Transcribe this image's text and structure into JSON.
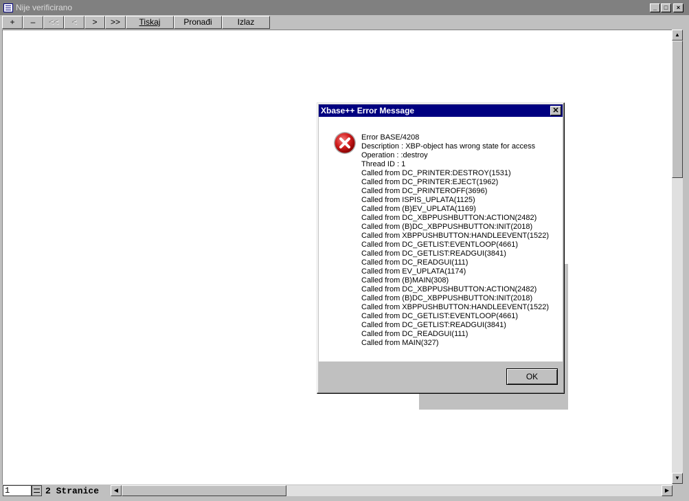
{
  "window": {
    "title": "Nije verificirano",
    "controls": [
      "_",
      "□",
      "×"
    ]
  },
  "toolbar": {
    "buttons": [
      {
        "label": "+",
        "enabled": true
      },
      {
        "label": "–",
        "enabled": true
      },
      {
        "label": "<<",
        "enabled": false
      },
      {
        "label": "<",
        "enabled": false
      },
      {
        "label": ">",
        "enabled": true
      },
      {
        "label": ">>",
        "enabled": true
      },
      {
        "label": "Tiskaj",
        "enabled": true
      },
      {
        "label": "Pronađi",
        "enabled": true
      },
      {
        "label": "Izlaz",
        "enabled": true
      }
    ]
  },
  "status": {
    "page_value": "1",
    "pages_label": "2 Stranice"
  },
  "dialog": {
    "title": "Xbase++ Error Message",
    "icon": "error-icon",
    "lines": [
      "Error BASE/4208",
      "Description : XBP-object has wrong state for access",
      "Operation : :destroy",
      "Thread ID : 1",
      "Called from DC_PRINTER:DESTROY(1531)",
      "Called from DC_PRINTER:EJECT(1962)",
      "Called from DC_PRINTEROFF(3696)",
      "Called from ISPIS_UPLATA(1125)",
      "Called from (B)EV_UPLATA(1169)",
      "Called from DC_XBPPUSHBUTTON:ACTION(2482)",
      "Called from (B)DC_XBPPUSHBUTTON:INIT(2018)",
      "Called from XBPPUSHBUTTON:HANDLEEVENT(1522)",
      "Called from DC_GETLIST:EVENTLOOP(4661)",
      "Called from DC_GETLIST:READGUI(3841)",
      "Called from DC_READGUI(111)",
      "Called from EV_UPLATA(1174)",
      "Called from (B)MAIN(308)",
      "Called from DC_XBPPUSHBUTTON:ACTION(2482)",
      "Called from (B)DC_XBPPUSHBUTTON:INIT(2018)",
      "Called from XBPPUSHBUTTON:HANDLEEVENT(1522)",
      "Called from DC_GETLIST:EVENTLOOP(4661)",
      "Called from DC_GETLIST:READGUI(3841)",
      "Called from DC_READGUI(111)",
      "Called from MAIN(327)"
    ],
    "ok_label": "OK"
  }
}
